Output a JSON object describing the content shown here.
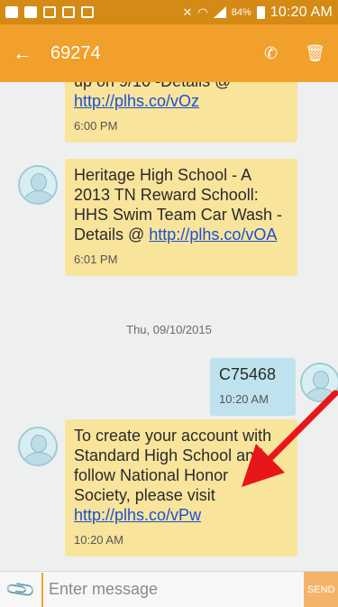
{
  "status_bar": {
    "battery": "84%",
    "time": "10:20 AM"
  },
  "toolbar": {
    "title": "69274",
    "back_icon": "back-arrow-icon",
    "call_icon": "phone-icon",
    "delete_icon": "trash-icon"
  },
  "messages": [
    {
      "text": "up on 9/10 -Details @ ",
      "link": "http://plhs.co/vOz",
      "time": "6:00 PM",
      "direction": "incoming"
    },
    {
      "text": "Heritage High School - A 2013 TN Reward Schooll: HHS Swim Team Car Wash -Details @ ",
      "link": "http://plhs.co/vOA",
      "time": "6:01 PM",
      "direction": "incoming"
    },
    {
      "text": "C75468",
      "time": "10:20 AM",
      "direction": "outgoing"
    },
    {
      "text": "To create your account with Standard High School and follow National Honor Society, please visit ",
      "link": "http://plhs.co/vPw",
      "time": "10:20 AM",
      "direction": "incoming"
    }
  ],
  "date_separator": "Thu, 09/10/2015",
  "composer": {
    "placeholder": "Enter message",
    "send_label": "SEND"
  },
  "colors": {
    "toolbar": "#f0a02b",
    "status_bar": "#d48a14",
    "incoming_bubble": "#f9e49c",
    "outgoing_bubble": "#bfe3ee",
    "link": "#1a4fd6",
    "annotation_arrow": "#e8161b"
  }
}
